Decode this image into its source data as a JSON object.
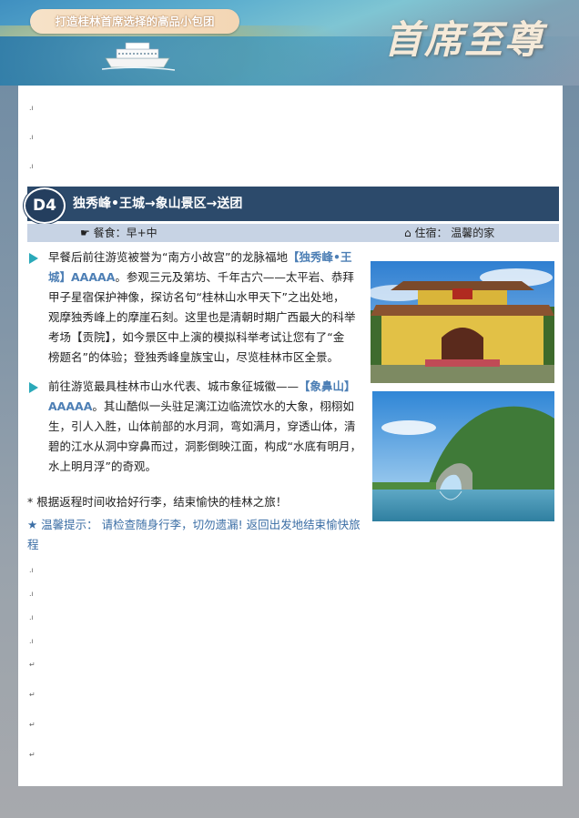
{
  "banner": {
    "slogan": "打造桂林首席选择的高品小包团",
    "logo_text": "首席至尊"
  },
  "day": {
    "badge": "D4",
    "title": "独秀峰•王城→象山景区→送团"
  },
  "info_bar": {
    "meal_icon": "hand-pointer-icon",
    "meal_label": "餐食：早+中",
    "stay_icon": "house-icon",
    "stay_label": "住宿：  温馨的家"
  },
  "itinerary": [
    {
      "lines": [
        {
          "pre": "早餐后前往游览被誉为“南方小故宫”的龙脉福地",
          "hl": "【独秀峰•王",
          "post": ""
        },
        {
          "pre": "",
          "hl": "城】AAAAA",
          "post": "。参观三元及第坊、千年古穴——太平岩、恭拜"
        },
        {
          "pre": "甲子星宿保护神像，探访名句“桂林山水甲天下”之出处地，",
          "hl": "",
          "post": ""
        },
        {
          "pre": "观摩独秀峰上的摩崖石刻。这里也是清朝时期广西最大的科举",
          "hl": "",
          "post": ""
        },
        {
          "pre": "考场【贡院】，如今景区中上演的模拟科举考试让您有了“金",
          "hl": "",
          "post": ""
        },
        {
          "pre": "榜题名”的体验；登独秀峰皇族宝山，尽览桂林市区全景。",
          "hl": "",
          "post": ""
        }
      ]
    },
    {
      "lines": [
        {
          "pre": "前往游览最具桂林市山水代表、城市象征城徽——",
          "hl": "【象鼻山】",
          "post": ""
        },
        {
          "pre": "",
          "hl": "AAAAA",
          "post": "。其山酷似一头驻足漓江边临流饮水的大象，栩栩如"
        },
        {
          "pre": "生，引人入胜，山体前部的水月洞，弯如满月，穿透山体，清",
          "hl": "",
          "post": ""
        },
        {
          "pre": "碧的江水从洞中穿鼻而过，洞影倒映江面，构成“水底有明月，",
          "hl": "",
          "post": ""
        },
        {
          "pre": "水上明月浮”的奇观。",
          "hl": "",
          "post": ""
        }
      ]
    }
  ],
  "notes": {
    "return": "* 根据返程时间收拾好行李，结束愉快的桂林之旅！",
    "tip": "★ 温馨提示： 请检查随身行李，切勿遗漏! 返回出发地结束愉快旅程"
  },
  "colors": {
    "header_bar": "#2c4a6b",
    "sub_bar": "#c7d3e4",
    "highlight": "#4d7fb5",
    "bullet": "#2aa9b9"
  }
}
